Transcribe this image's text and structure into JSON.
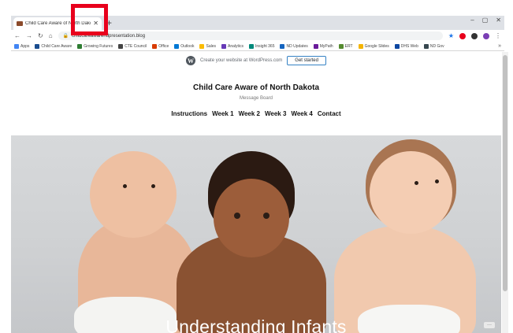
{
  "browser": {
    "tab": {
      "title": "Child Care Aware of North Dakota"
    },
    "new_tab": "+",
    "window_controls": [
      "–",
      "▢",
      "✕"
    ],
    "address": {
      "url": "childcareawarendpresentation.blog"
    }
  },
  "bookmarks": [
    {
      "label": "Apps",
      "color": "#4285f4"
    },
    {
      "label": "Child Care Aware",
      "color": "#1a4d8f"
    },
    {
      "label": "Growing Futures",
      "color": "#2e7d32"
    },
    {
      "label": "CTE Council",
      "color": "#444444"
    },
    {
      "label": "Office",
      "color": "#d83b01"
    },
    {
      "label": "Outlook",
      "color": "#0078d4"
    },
    {
      "label": "Sales",
      "color": "#fbbc04"
    },
    {
      "label": "Analytics",
      "color": "#673ab7"
    },
    {
      "label": "Insight 365",
      "color": "#00897b"
    },
    {
      "label": "ND Updates",
      "color": "#1565c0"
    },
    {
      "label": "MyPath",
      "color": "#6a1b9a"
    },
    {
      "label": "ERT",
      "color": "#558b2f"
    },
    {
      "label": "Google Slides",
      "color": "#f4b400"
    },
    {
      "label": "DHS Web",
      "color": "#0d47a1"
    },
    {
      "label": "ND Gov",
      "color": "#37474f"
    }
  ],
  "bookmarks_more": "»",
  "wordpress_banner": {
    "text": "Create your website at WordPress.com",
    "button": "Get started"
  },
  "site": {
    "title": "Child Care Aware of North Dakota",
    "description": "Message Board",
    "nav": [
      "Instructions",
      "Week 1",
      "Week 2",
      "Week 3",
      "Week 4",
      "Contact"
    ]
  },
  "hero": {
    "heading": "Understanding Infants",
    "more": "···"
  },
  "colors": {
    "highlight": "#e8001c",
    "link": "#1a73e8"
  }
}
